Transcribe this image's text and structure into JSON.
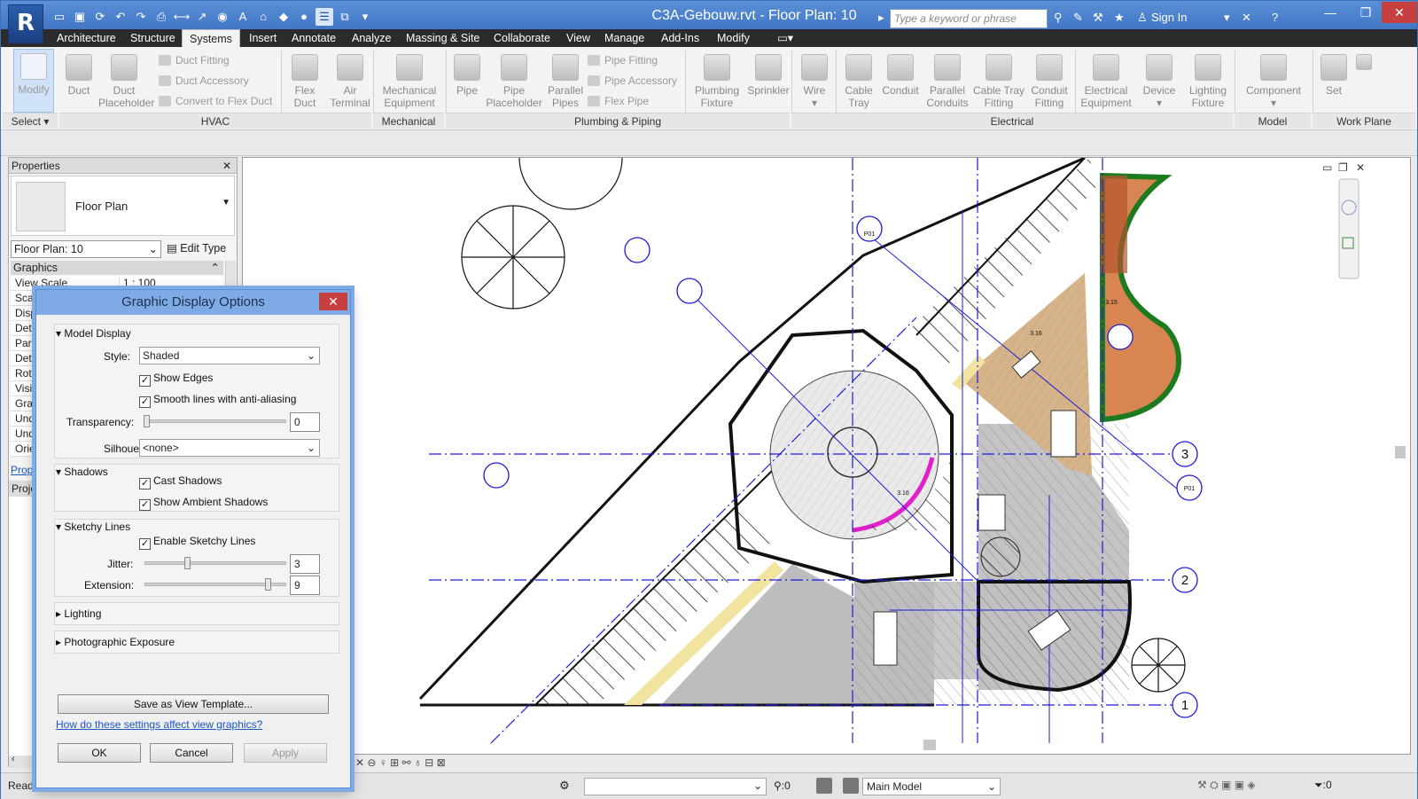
{
  "window": {
    "title": "C3A-Gebouw.rvt - Floor Plan: 10",
    "search_placeholder": "Type a keyword or phrase",
    "sign_in": "Sign In"
  },
  "menu": [
    "Architecture",
    "Structure",
    "Systems",
    "Insert",
    "Annotate",
    "Analyze",
    "Massing & Site",
    "Collaborate",
    "View",
    "Manage",
    "Add-Ins",
    "Modify"
  ],
  "ribbon": {
    "modify": "Modify",
    "duct": "Duct",
    "duct_placeholder": [
      "Duct",
      "Placeholder"
    ],
    "duct_fitting": "Duct  Fitting",
    "duct_accessory": "Duct  Accessory",
    "convert_flex": "Convert to  Flex Duct",
    "flex_duct": [
      "Flex",
      "Duct"
    ],
    "air_terminal": [
      "Air",
      "Terminal"
    ],
    "mech_equipment": [
      "Mechanical",
      "Equipment"
    ],
    "pipe": "Pipe",
    "pipe_placeholder": [
      "Pipe",
      "Placeholder"
    ],
    "parallel_pipes": [
      "Parallel",
      "Pipes"
    ],
    "pipe_fitting": "Pipe  Fitting",
    "pipe_accessory": "Pipe  Accessory",
    "flex_pipe": "Flex  Pipe",
    "plumbing_fixture": [
      "Plumbing",
      "Fixture"
    ],
    "sprinkler": "Sprinkler",
    "wire": "Wire",
    "cable_tray": [
      "Cable",
      "Tray"
    ],
    "conduit": "Conduit",
    "parallel_conduits": [
      "Parallel",
      "Conduits"
    ],
    "cable_tray_fitting": [
      "Cable Tray",
      "Fitting"
    ],
    "conduit_fitting": [
      "Conduit",
      "Fitting"
    ],
    "electrical_equipment": [
      "Electrical",
      "Equipment"
    ],
    "device": "Device",
    "lighting_fixture": [
      "Lighting",
      "Fixture"
    ],
    "component": "Component",
    "set": "Set",
    "panels": {
      "select": "Select",
      "hvac": "HVAC",
      "mechanical": "Mechanical",
      "plumbing": "Plumbing & Piping",
      "electrical": "Electrical",
      "model": "Model",
      "workplane": "Work Plane"
    }
  },
  "properties": {
    "title": "Properties",
    "type": "Floor Plan",
    "selector": "Floor Plan: 10",
    "edit_type": "Edit Type",
    "group": "Graphics",
    "rows": [
      {
        "k": "View Scale",
        "v": "1 : 100"
      },
      {
        "k": "Scale",
        "v": ""
      },
      {
        "k": "Disp",
        "v": ""
      },
      {
        "k": "Deta",
        "v": ""
      },
      {
        "k": "Parts",
        "v": ""
      },
      {
        "k": "Deta",
        "v": ""
      },
      {
        "k": "Rota",
        "v": ""
      },
      {
        "k": "Visib",
        "v": ""
      },
      {
        "k": "Grap",
        "v": ""
      },
      {
        "k": "Unde",
        "v": ""
      },
      {
        "k": "Unde",
        "v": ""
      },
      {
        "k": "Orien",
        "v": ""
      }
    ],
    "link": "Prope",
    "project_browser": "Projec"
  },
  "dialog": {
    "title": "Graphic Display Options",
    "model_display": "Model Display",
    "style_label": "Style:",
    "style_value": "Shaded",
    "show_edges": "Show Edges",
    "smooth_lines": "Smooth lines with anti-aliasing",
    "transparency_label": "Transparency:",
    "transparency_value": "0",
    "silhouettes_label": "Silhouettes:",
    "silhouettes_value": "<none>",
    "shadows": "Shadows",
    "cast_shadows": "Cast Shadows",
    "ambient_shadows": "Show Ambient Shadows",
    "sketchy_lines": "Sketchy Lines",
    "enable_sketchy": "Enable Sketchy Lines",
    "jitter_label": "Jitter:",
    "jitter_value": "3",
    "extension_label": "Extension:",
    "extension_value": "9",
    "lighting": "Lighting",
    "photo_exposure": "Photographic Exposure",
    "save_template": "Save as View Template...",
    "help_link": "How do these settings affect view graphics?",
    "ok": "OK",
    "cancel": "Cancel",
    "apply": "Apply"
  },
  "drawing": {
    "grid_labels": [
      "3",
      "2",
      "1"
    ],
    "tags": [
      "P01",
      "P01"
    ],
    "room_labels": [
      "3.16",
      "3.16",
      "3.15"
    ]
  },
  "status": {
    "ready": "Ready",
    "sel_count": ":0",
    "workset": "Main Model",
    "filter": ":0"
  },
  "colors": {
    "accent": "#3d72c4",
    "grid_line": "#1c1cdc",
    "wood": "#d6b388",
    "terrace": "#d98552",
    "green": "#1e7a1e",
    "magenta": "#e020c8"
  }
}
